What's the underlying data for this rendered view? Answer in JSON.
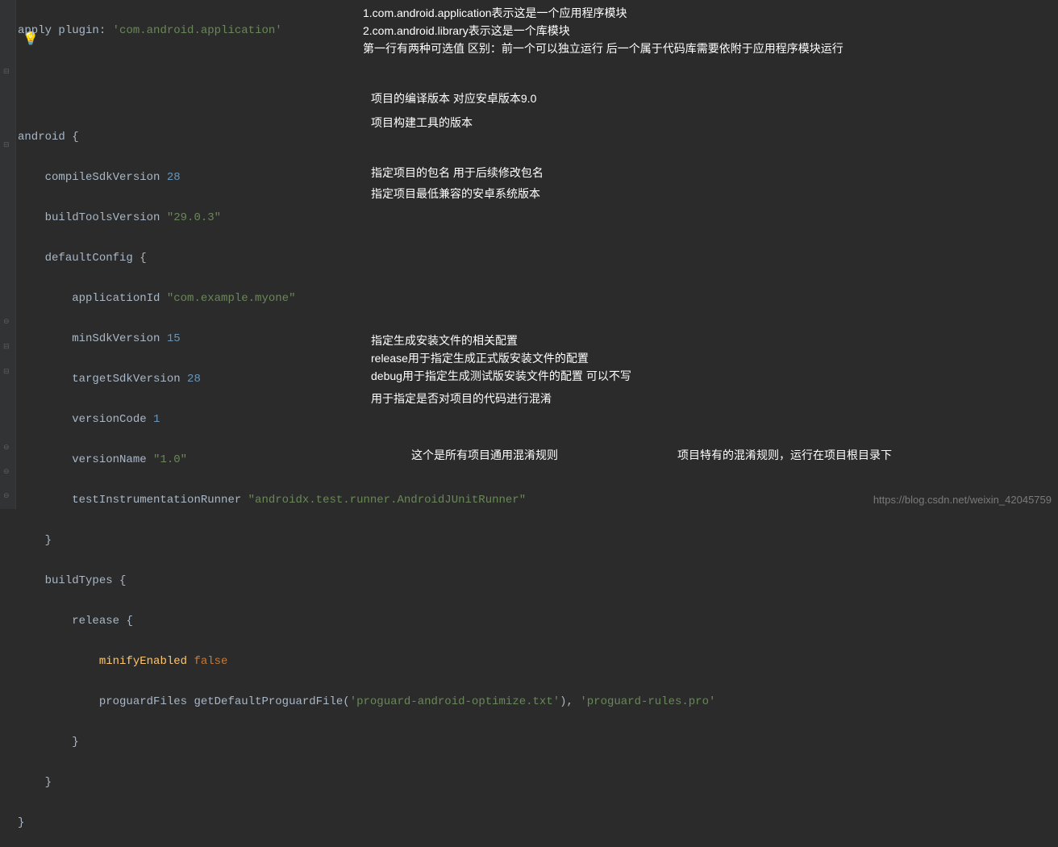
{
  "code": {
    "l1_apply": "apply",
    "l1_plugin": " plugin: ",
    "l1_str": "'com.android.application'",
    "l3_android": "android ",
    "brace_open": "{",
    "brace_close": "}",
    "l4_compile": "compileSdkVersion ",
    "l4_num": "28",
    "l5_build": "buildToolsVersion ",
    "l5_str": "\"29.0.3\"",
    "l6_default": "defaultConfig ",
    "l7_appid": "applicationId ",
    "l7_str": "\"com.example.myone\"",
    "l8_minsdk": "minSdkVersion ",
    "l8_num": "15",
    "l9_target": "targetSdkVersion ",
    "l9_num": "28",
    "l10_vercode": "versionCode ",
    "l10_num": "1",
    "l11_vername": "versionName ",
    "l11_str": "\"1.0\"",
    "l12_test": "testInstrumentationRunner ",
    "l12_str": "\"androidx.test.runner.AndroidJUnitRunner\"",
    "l14_buildtypes": "buildTypes ",
    "l15_release": "release ",
    "l16_minify": "minifyEnabled ",
    "l16_false": "false",
    "l17_proguard": "proguardFiles ",
    "l17_getdef": "getDefaultProguardFile(",
    "l17_str1": "'proguard-android-optimize.txt'",
    "l17_paren": "), ",
    "l17_str2": "'proguard-rules.pro'"
  },
  "annotations": {
    "a1": "1.com.android.application表示这是一个应用程序模块",
    "a2": "2.com.android.library表示这是一个库模块",
    "a3": "第一行有两种可选值   区别：前一个可以独立运行 后一个属于代码库需要依附于应用程序模块运行",
    "a4": "项目的编译版本  对应安卓版本9.0",
    "a5": "项目构建工具的版本",
    "a6": "指定项目的包名 用于后续修改包名",
    "a7": "指定项目最低兼容的安卓系统版本",
    "a8": "指定生成安装文件的相关配置",
    "a9": "release用于指定生成正式版安装文件的配置",
    "a10": "debug用于指定生成测试版安装文件的配置 可以不写",
    "a11": "用于指定是否对项目的代码进行混淆",
    "a12": "这个是所有项目通用混淆规则",
    "a13": "项目特有的混淆规则，运行在项目根目录下"
  },
  "icons": {
    "bulb": "💡"
  },
  "watermark": "https://blog.csdn.net/weixin_42045759"
}
